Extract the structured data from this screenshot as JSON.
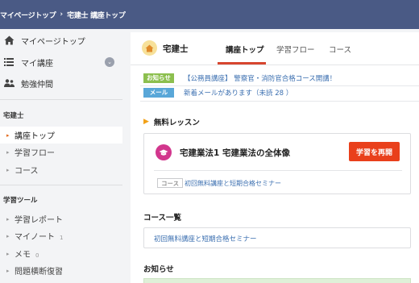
{
  "breadcrumb": {
    "home": "マイページトップ",
    "current": "宅建士 講座トップ"
  },
  "sidebar": {
    "top_items": [
      {
        "icon": "home-icon",
        "label": "マイページトップ"
      },
      {
        "icon": "list-icon",
        "label": "マイ講座",
        "badge": "⌄"
      },
      {
        "icon": "users-icon",
        "label": "勉強仲間"
      }
    ],
    "course_section": {
      "title": "宅建士",
      "items": [
        {
          "label": "講座トップ",
          "active": true
        },
        {
          "label": "学習フロー"
        },
        {
          "label": "コース"
        }
      ]
    },
    "tools_section": {
      "title": "学習ツール",
      "items": [
        {
          "label": "学習レポート",
          "count": ""
        },
        {
          "label": "マイノート",
          "count": "1"
        },
        {
          "label": "メモ",
          "count": "0"
        },
        {
          "label": "問題横断復習",
          "count": ""
        }
      ]
    }
  },
  "course": {
    "name": "宅建士",
    "icon": "house-icon",
    "tabs": [
      "講座トップ",
      "学習フロー",
      "コース"
    ],
    "active_tab": 0
  },
  "notices": [
    {
      "tag": "お知らせ",
      "tag_color": "#8cbf4e",
      "text": "【公務員講座】 警察官・消防官合格コース開講！"
    },
    {
      "tag": "メール",
      "tag_color": "#59a7d8",
      "text": "新着メールがあります（未読 28 ）"
    }
  ],
  "free_lesson": {
    "heading": "無料レッスン",
    "title": "宅建業法1 宅建業法の全体像",
    "button": "学習を再開",
    "course_tag": "コース",
    "link": "初回無料講座と短期合格セミナー"
  },
  "course_list": {
    "heading": "コース一覧",
    "link": "初回無料講座と短期合格セミナー"
  },
  "news": {
    "heading": "お知らせ"
  },
  "colors": {
    "topbar": "#4a5a85",
    "accent": "#e9401b",
    "link": "#3b6fb0"
  }
}
